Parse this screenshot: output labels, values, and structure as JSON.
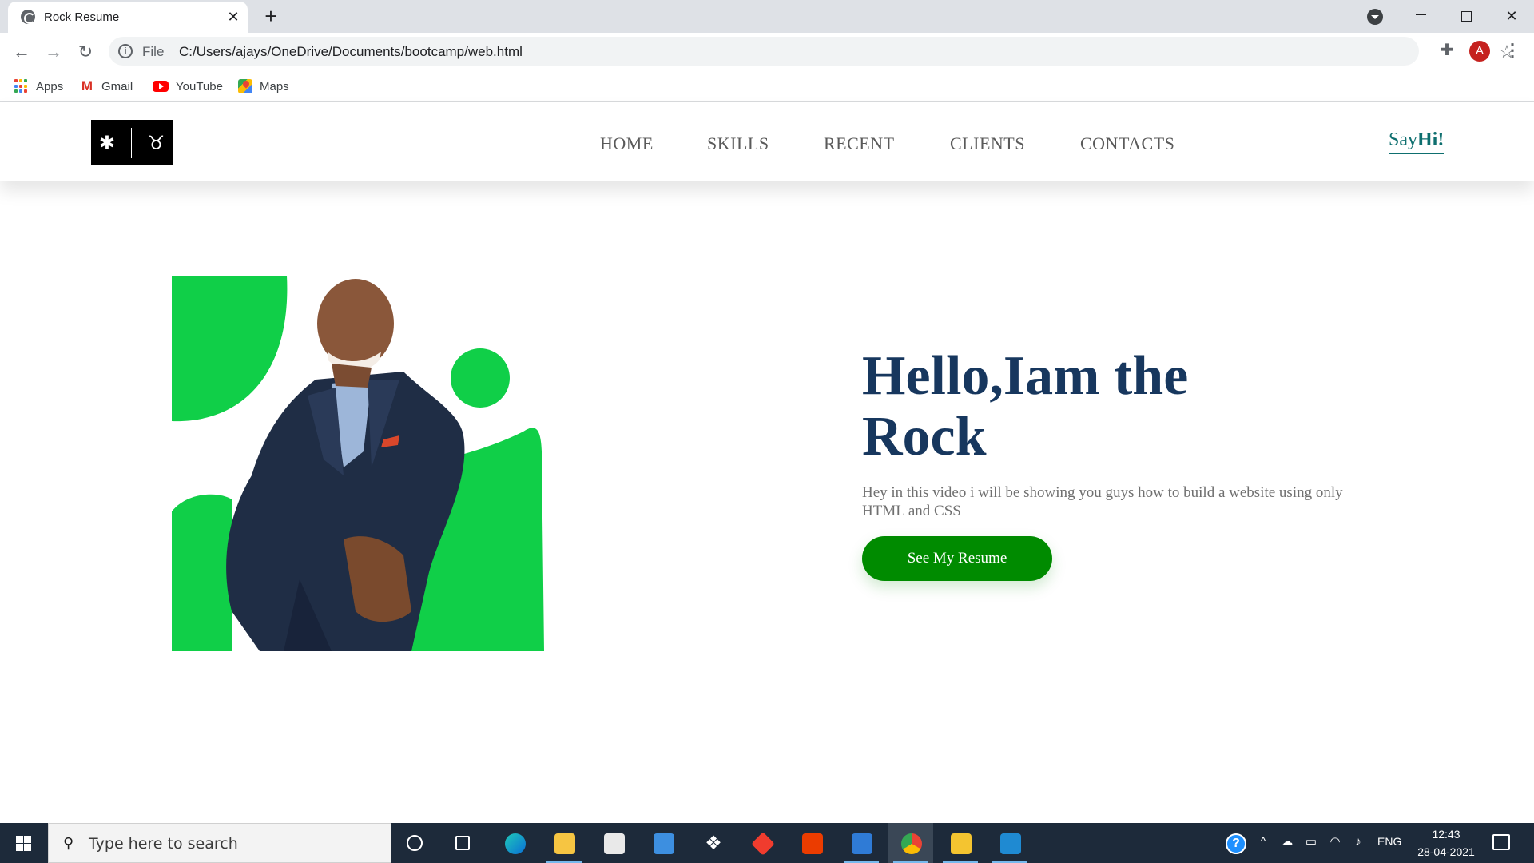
{
  "browser": {
    "tab_title": "Rock Resume",
    "tab_close": "✕",
    "new_tab": "+",
    "url_scheme": "File",
    "url": "C:/Users/ajays/OneDrive/Documents/bootcamp/web.html",
    "profile_initial": "A",
    "bookmarks": [
      {
        "label": "Apps",
        "icon": "apps-grid-icon"
      },
      {
        "label": "Gmail",
        "icon": "gmail-icon"
      },
      {
        "label": "YouTube",
        "icon": "youtube-icon"
      },
      {
        "label": "Maps",
        "icon": "maps-icon"
      }
    ],
    "colors": {
      "tabstrip": "#dee1e6",
      "omnibox": "#f1f3f4",
      "profile": "#c5221f"
    }
  },
  "site": {
    "logo_left": "✱",
    "logo_right": "♉",
    "nav": [
      "HOME",
      "SKILLS",
      "RECENT",
      "CLIENTS",
      "CONTACTS"
    ],
    "sayhi_prefix": "Say",
    "sayhi_bold": "Hi!",
    "hero": {
      "title": "Hello,Iam the Rock",
      "subtitle": "Hey in this video i will be showing you guys how to build a website using only HTML and CSS",
      "button": "See My Resume"
    },
    "colors": {
      "accent_green": "#10cf48",
      "button_green": "#008b00",
      "title_navy": "#17375e",
      "sayhi_teal": "#0e6f6f"
    }
  },
  "taskbar": {
    "search_placeholder": "Type here to search",
    "apps": [
      "cortana-icon",
      "task-view-icon",
      "edge-icon",
      "file-explorer-icon",
      "store-icon",
      "mail-icon",
      "dropbox-icon",
      "git-icon",
      "office-icon",
      "photos-icon",
      "chrome-icon",
      "notes-icon",
      "vscode-icon"
    ],
    "help": "?",
    "language": "ENG",
    "time": "12:43",
    "date": "28-04-2021"
  }
}
